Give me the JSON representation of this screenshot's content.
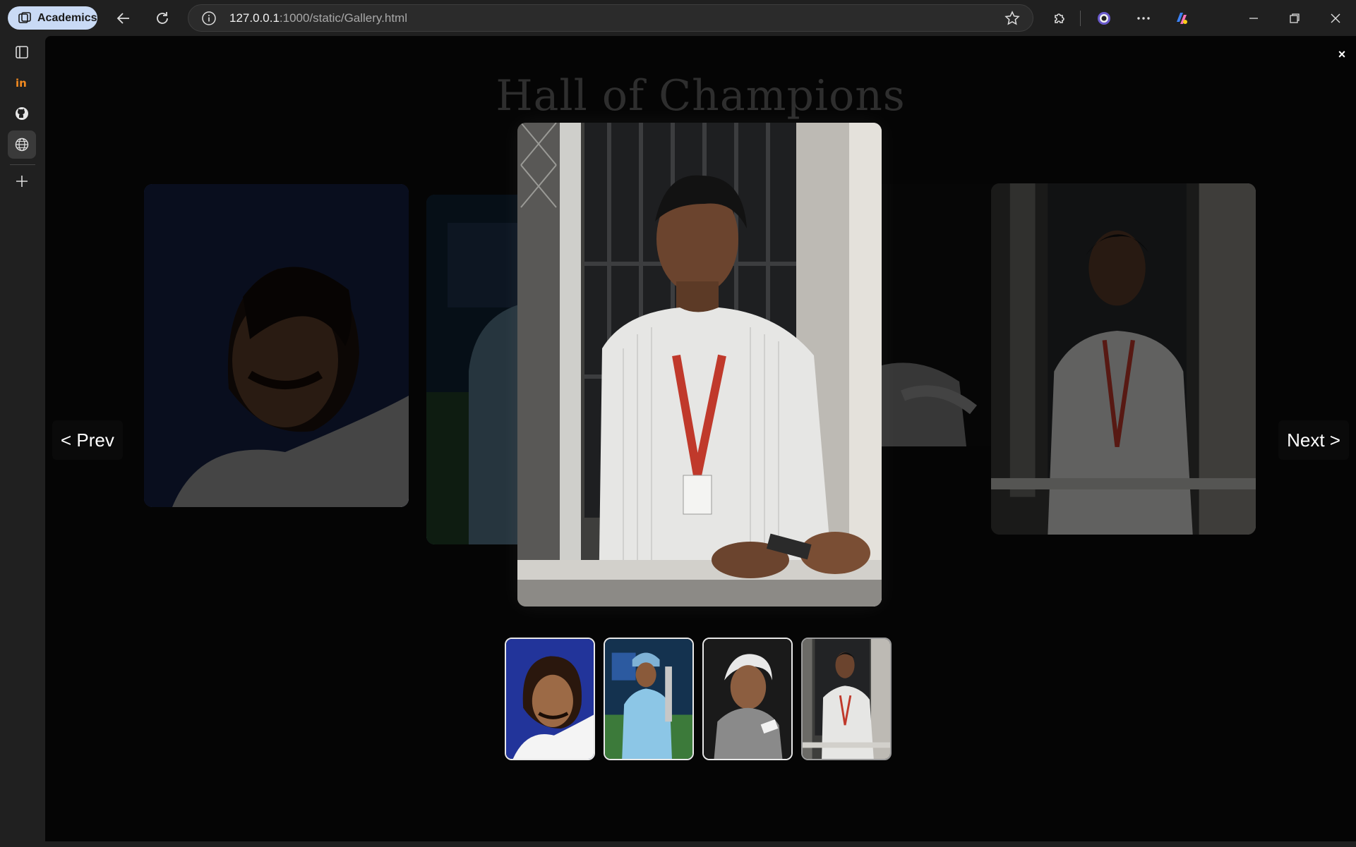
{
  "browser": {
    "profile_label": "Academics",
    "url_host": "127.0.0.1",
    "url_rest": ":1000/static/Gallery.html",
    "accent": "#c9daf5"
  },
  "sidebar": {
    "items": [
      {
        "icon": "sidebar-panel-icon"
      },
      {
        "icon": "invision-icon"
      },
      {
        "icon": "github-icon"
      },
      {
        "icon": "globe-icon"
      },
      {
        "icon": "plus-icon"
      }
    ]
  },
  "gallery": {
    "title": "Hall of Champions",
    "close_label": "×",
    "prev_label": "< Prev",
    "next_label": "Next >",
    "active_index": 3,
    "thumbnail_count": 4
  },
  "colors": {
    "page_bg": "#050505",
    "chrome_bg": "#202020",
    "title_color": "#2e2e2e"
  }
}
